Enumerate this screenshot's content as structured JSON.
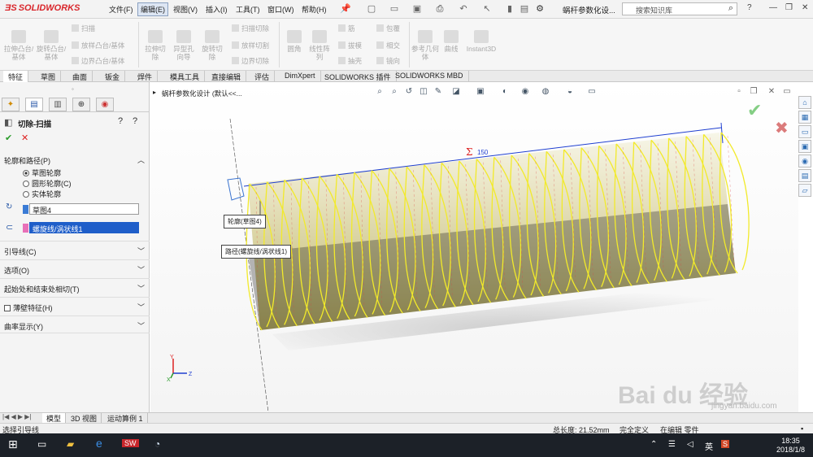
{
  "app": {
    "logo_ds": "ƎS",
    "logo_name": "SOLIDWORKS"
  },
  "menu": [
    "文件(F)",
    "编辑(E)",
    "视图(V)",
    "插入(I)",
    "工具(T)",
    "窗口(W)",
    "帮助(H)"
  ],
  "document_title": "蜗杆参数化设...",
  "search": {
    "placeholder": "搜索知识库"
  },
  "ribbon": {
    "large": [
      "拉伸凸台/基体",
      "旋转凸台/基体",
      "拉伸切除",
      "异型孔向导",
      "旋转切除",
      "圆角",
      "线性阵列",
      "参考几何体",
      "曲线",
      "Instant3D"
    ],
    "small": [
      "扫描",
      "放样凸台/基体",
      "边界凸台/基体",
      "扫描切除",
      "放样切割",
      "边界切除",
      "筋",
      "拔模",
      "抽壳",
      "包覆",
      "相交",
      "镜向"
    ]
  },
  "tabs": [
    "特征",
    "草图",
    "曲面",
    "钣金",
    "焊件",
    "模具工具",
    "直接编辑",
    "评估",
    "DimXpert",
    "SOLIDWORKS 插件",
    "SOLIDWORKS MBD"
  ],
  "property_manager": {
    "title": "切除-扫描",
    "sections": {
      "profile_path": "轮廓和路径(P)",
      "guide": "引导线(C)",
      "options": "选项(O)",
      "start_end": "起始处和结束处相切(T)",
      "thin": "薄壁特征(H)",
      "curvature": "曲率显示(Y)"
    },
    "radios": [
      "草图轮廓",
      "圆形轮廓(C)",
      "实体轮廓"
    ],
    "profile_value": "草图4",
    "path_value": "螺旋线/涡状线1"
  },
  "viewport": {
    "breadcrumb": "蜗杆参数化设计  (默认<<...",
    "dimension": "150",
    "callouts": {
      "profile": "轮廓(草图4)",
      "path": "路径(螺旋线/涡状线1)"
    },
    "axes": {
      "x": "X",
      "y": "Y",
      "z": "Z"
    }
  },
  "model_tabs": [
    "模型",
    "3D 视图",
    "运动算例 1"
  ],
  "status": {
    "hint": "选择引导线",
    "length": "总长度: 21.52mm",
    "defined": "完全定义",
    "editing": "在编辑 零件"
  },
  "taskbar": {
    "time": "18:35",
    "date": "2018/1/8",
    "ime": "英"
  },
  "watermark": "Bai du 经验",
  "watermark_url": "jingyan.baidu.com",
  "colors": {
    "accent": "#d9262b",
    "selection": "#1f5ec9",
    "helix": "#f2ea2a",
    "taskbar": "#1c2128"
  }
}
